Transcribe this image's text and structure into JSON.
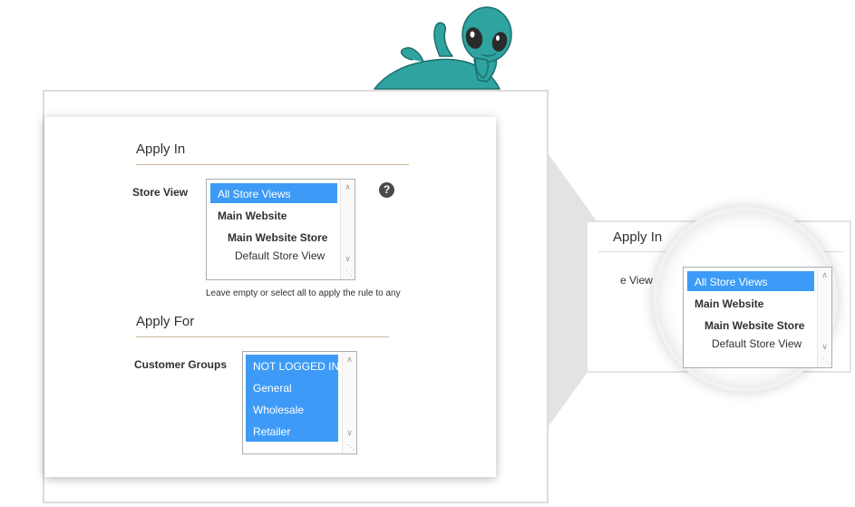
{
  "left_panel": {
    "apply_in": {
      "title": "Apply In",
      "store_view_label": "Store View",
      "store_view_options": [
        {
          "label": "All Store Views",
          "selected": true
        },
        {
          "label": "Main Website",
          "selected": false
        },
        {
          "label": "Main Website Store",
          "selected": false
        },
        {
          "label": "Default Store View",
          "selected": false
        }
      ],
      "help_icon": "?",
      "hint": "Leave empty or select all to apply the rule to any"
    },
    "apply_for": {
      "title": "Apply For",
      "customer_groups_label": "Customer Groups",
      "customer_group_options": [
        {
          "label": "NOT LOGGED IN",
          "selected": true
        },
        {
          "label": "General",
          "selected": true
        },
        {
          "label": "Wholesale",
          "selected": true
        },
        {
          "label": "Retailer",
          "selected": true
        }
      ]
    }
  },
  "zoom_panel": {
    "title": "Apply In",
    "partial_label": "e View",
    "store_view_options": [
      {
        "label": "All Store Views",
        "selected": true
      },
      {
        "label": "Main Website",
        "selected": false
      },
      {
        "label": "Main Website Store",
        "selected": false
      },
      {
        "label": "Default Store View",
        "selected": false
      }
    ]
  },
  "icons": {
    "mascot": "alien-mascot-icon",
    "help": "question-mark-icon",
    "scroll_up": "chevron-up-icon",
    "scroll_down": "chevron-down-icon",
    "resize": "resize-grip-icon"
  },
  "colors": {
    "selection": "#3d9bf7",
    "rule": "#c9b99a",
    "mascot": "#2fa3a0"
  }
}
